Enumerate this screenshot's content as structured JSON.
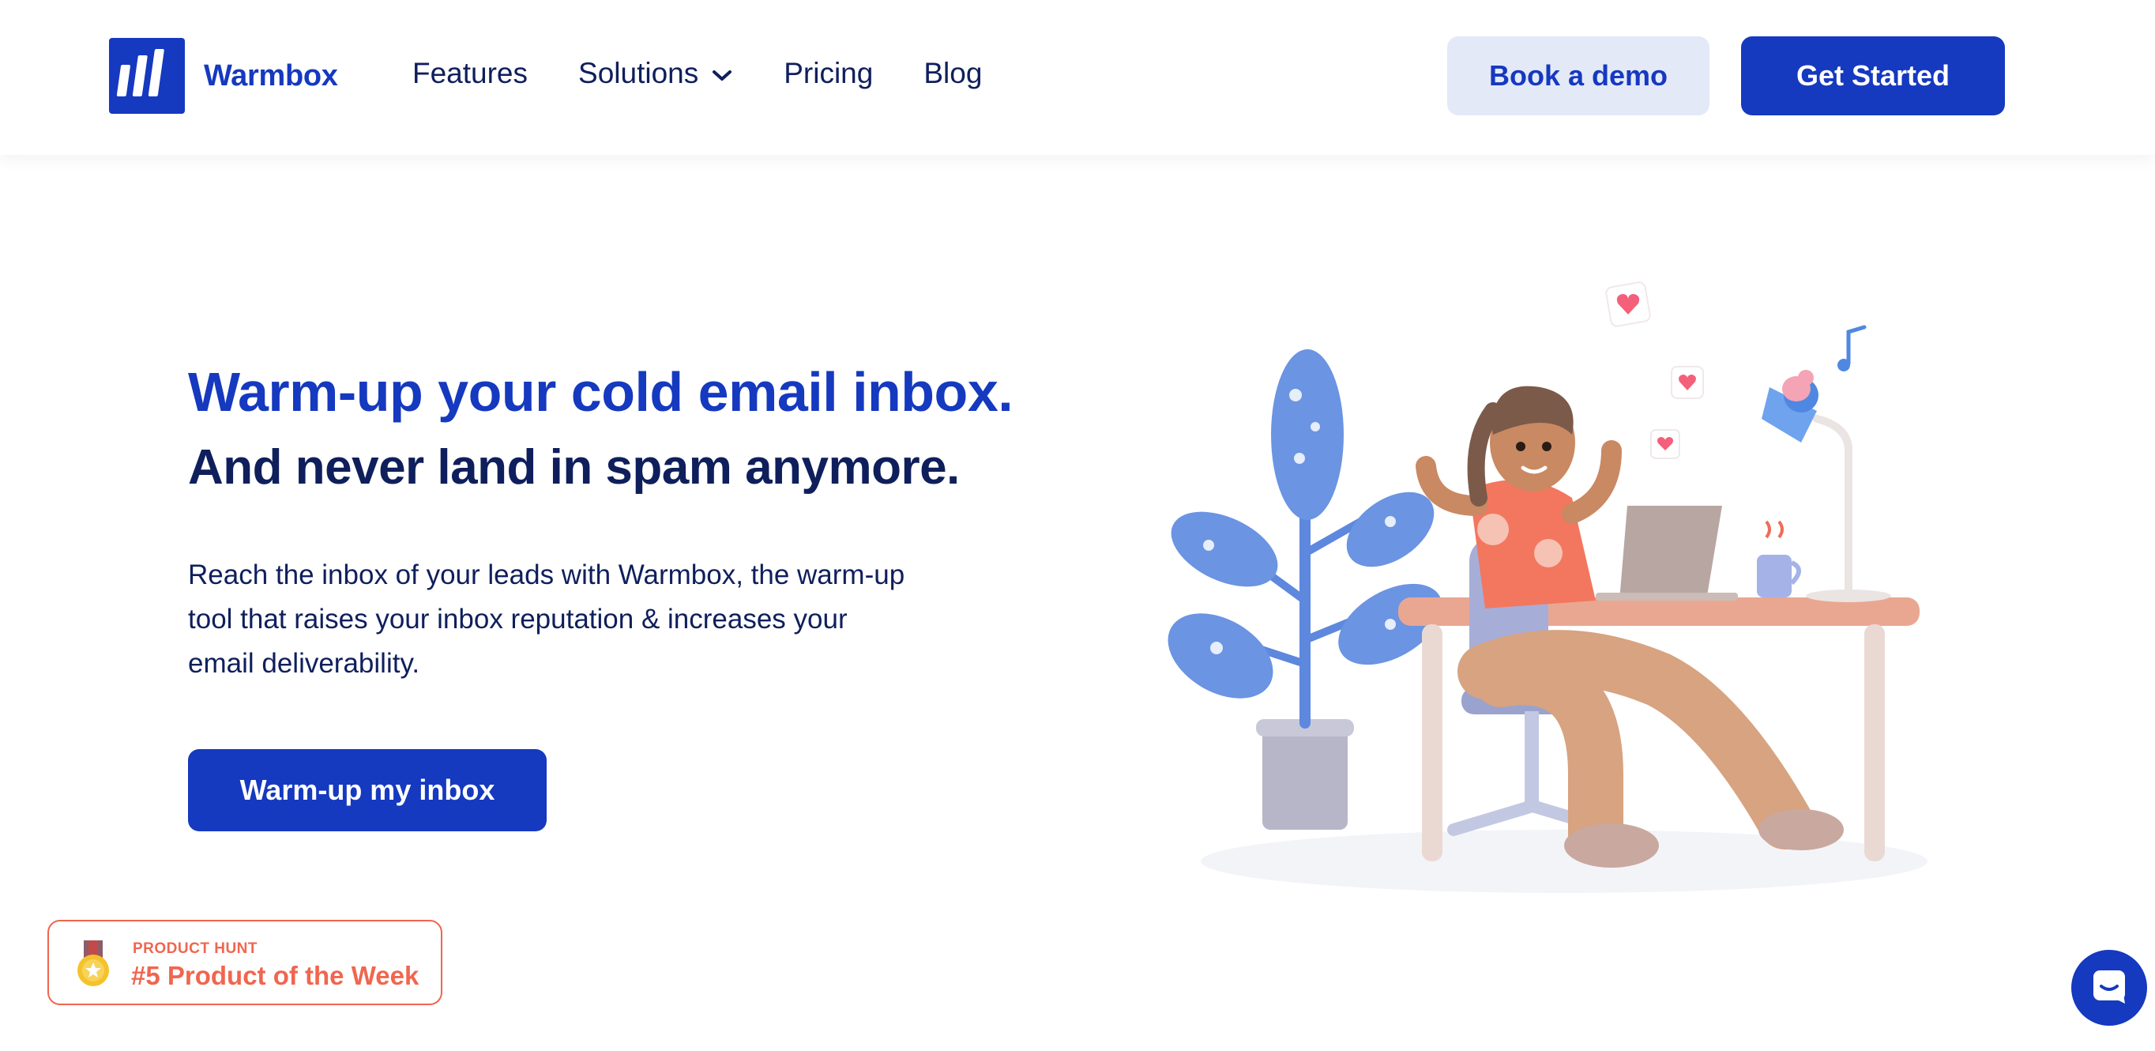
{
  "brand": {
    "name": "Warmbox",
    "color": "#1539bf",
    "logo_icon": "warmbox-logo-icon"
  },
  "nav": {
    "items": [
      {
        "label": "Features"
      },
      {
        "label": "Solutions",
        "icon": "chevron-down-icon"
      },
      {
        "label": "Pricing"
      },
      {
        "label": "Blog"
      }
    ]
  },
  "header_actions": {
    "demo_label": "Book a demo",
    "start_label": "Get Started"
  },
  "hero": {
    "title": "Warm-up your cold email inbox.",
    "subtitle": "And never land in spam anymore.",
    "description": "Reach the inbox of your leads with Warmbox, the warm-up tool that raises your inbox reputation & increases your email deliverability.",
    "cta_label": "Warm-up my inbox"
  },
  "product_hunt": {
    "label": "PRODUCT HUNT",
    "title": "#5 Product of the Week",
    "icon": "medal-icon",
    "color": "#f0664f"
  },
  "chat": {
    "icon": "chat-icon"
  },
  "colors": {
    "primary": "#1539bf",
    "dark_text": "#0f1f5c",
    "light_button": "#e4e9f8",
    "accent": "#f0664f"
  }
}
